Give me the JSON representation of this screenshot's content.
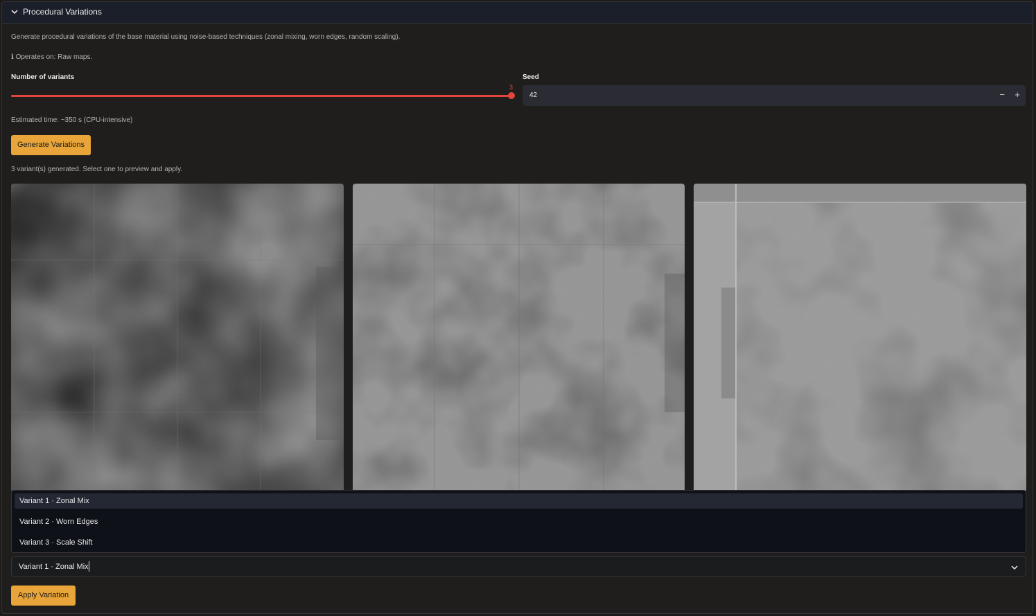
{
  "panel": {
    "title": "Procedural Variations",
    "description": "Generate procedural variations of the base material using noise-based techniques (zonal mixing, worn edges, random scaling).",
    "operates_on": "ℹ Operates on: Raw maps.",
    "num_variants_label": "Number of variants",
    "num_variants_value": "3",
    "seed_label": "Seed",
    "seed_value": "42",
    "seed_minus": "−",
    "seed_plus": "+",
    "estimated_time": "Estimated time: ~350 s (CPU-intensive)",
    "generate_button": "Generate Variations",
    "status": "3 variant(s) generated. Select one to preview and apply.",
    "options": [
      "Variant 1 · Zonal Mix",
      "Variant 2 · Worn Edges",
      "Variant 3 · Scale Shift"
    ],
    "selected_option": "Variant 1 · Zonal Mix",
    "apply_button": "Apply Variation"
  },
  "colors": {
    "accent": "#e9a53a",
    "slider": "#e2453c",
    "background": "#1f1e1c",
    "header": "#1b1f29"
  }
}
